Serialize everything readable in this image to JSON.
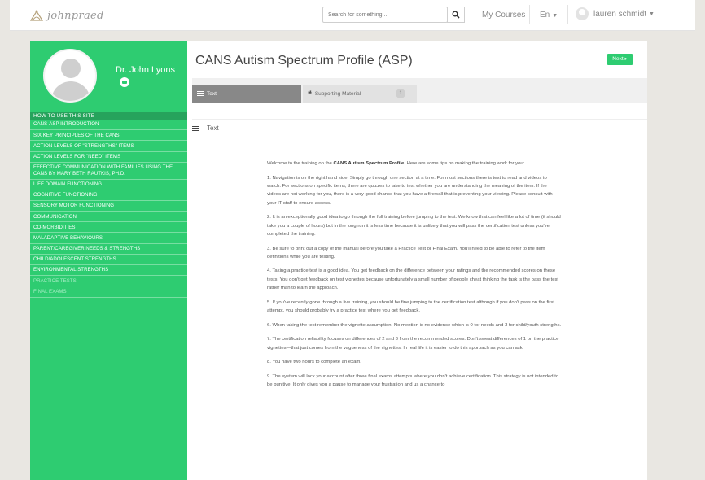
{
  "header": {
    "logo_text": "johnpraed",
    "search_placeholder": "Search for something...",
    "my_courses": "My Courses",
    "language": "En",
    "user_name": "lauren schmidt"
  },
  "sidebar": {
    "instructor_name": "Dr. John Lyons",
    "menu_header": "HOW TO USE THIS SITE",
    "items": [
      "CANS-ASP INTRODUCTION",
      "SIX KEY PRINCIPLES OF THE CANS",
      "ACTION LEVELS OF \"STRENGTHS\" ITEMS",
      "ACTION LEVELS FOR \"NEED\" ITEMS",
      "EFFECTIVE COMMUNICATION WITH FAMILIES USING THE CANS BY MARY BETH RAUTKIS, PH.D.",
      "LIFE DOMAIN FUNCTIONING",
      "COGNITIVE FUNCTIONING",
      "SENSORY MOTOR FUNCTIONING",
      "COMMUNICATION",
      "CO-MORBIDITIES",
      "MALADAPTIVE BEHAVIOURS",
      "PARENT/CAREGIVER NEEDS & STRENGTHS",
      "CHILD/ADOLESCENT STRENGTHS",
      "ENVIRONMENTAL STRENGTHS",
      "PRACTICE TESTS",
      "FINAL EXAMS"
    ]
  },
  "main": {
    "title": "CANS Autism Spectrum Profile (ASP)",
    "next_label": "Next",
    "tabs": {
      "text": "Text",
      "supporting": "Supporting Material",
      "supporting_count": "1"
    },
    "section_label": "Text",
    "content": {
      "intro_before": "Welcome to the training on the ",
      "intro_bold": "CANS Autism Spectrum Profile",
      "intro_after": ". Here are some tips on making the training work for you:",
      "tips": [
        "1. Navigation is on the right hand side. Simply go through one section at a time. For most sections there is text to read and videos to watch. For sections on specific items, there are quizzes to take to test whether you are understanding the meaning of the item.  If the videos are not working for you, there is a very good chance that you have a firewall that is preventing your viewing.  Please consult with your IT staff to ensure access.",
        "2. It is an exceptionally good idea to go through the full training before jumping to the test. We know that can feel like a lot of time (it should take you a couple of hours) but in the long run it is less time because it is unlikely that you will pass the certification test unless you've completed the training.",
        "3. Be sure to print out a copy of the manual before you take a Practice Test or Final Exam.  You'll need to be able to refer to the item definitions while you are testing.",
        "4. Taking a practice test is a good idea. You get feedback on the difference between your ratings and the recommended scores on these tests. You don't get feedback on test vignettes because unfortunately a small number of people cheat thinking the task is the pass the test rather than to learn the approach.",
        "5. If you've recently gone through a live training, you should be fine jumping to the certification test although if you don't pass on the first attempt, you should probably try a practice test where you get feedback.",
        "6. When taking the test remember the vignette assumption. No mention is no evidence which is 0 for needs and 3 for child/youth strengths.",
        "7. The certification reliability focuses on differences of 2 and 3 from the recommended scores. Don't sweat differences of 1 on the practice vignettes—that just comes from the vagueness of the vignettes. In real life it is easier to do this approach as you can ask.",
        "8. You have two hours to complete an exam.",
        "9. The system will lock your account after three final exams attempts where you don't achieve certification. This strategy is not intended to be punitive. It only gives you a pause to manage your frustration and us a chance to"
      ]
    }
  },
  "colors": {
    "accent_green": "#2ecc71",
    "sidebar_header": "#26a35c",
    "tab_active": "#888888"
  }
}
